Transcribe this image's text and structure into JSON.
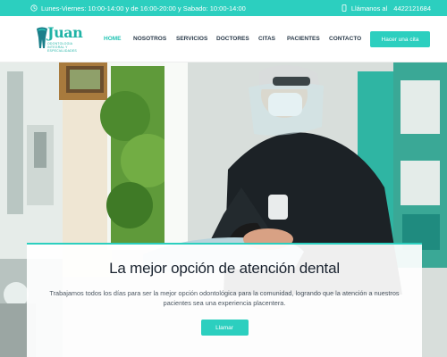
{
  "topbar": {
    "hours": "Lunes-Viernes: 10:00-14:00 y de 16:00-20:00 y Sabado: 10:00-14:00",
    "call_label": "Llámanos al",
    "phone": "4422121684",
    "clock_icon": "clock-icon",
    "phone_icon": "phone-icon"
  },
  "header": {
    "logo_word": "Juan",
    "logo_sub": "ODONTOLOGIA INTEGRAL Y ESPECIALIDADES",
    "nav": [
      {
        "label": "HOME"
      },
      {
        "label": "NOSOTROS"
      },
      {
        "label": "SERVICIOS"
      },
      {
        "label": "DOCTORES"
      },
      {
        "label": "CITAS"
      },
      {
        "label": "PACIENTES"
      },
      {
        "label": "CONTACTO"
      }
    ],
    "cta": "Hacer una cita"
  },
  "hero": {
    "title": "La mejor opción de atención dental",
    "text": "Trabajamos todos los días para ser la mejor opción odontológica para la comunidad, logrando que la atención a nuestros pacientes sea una experiencia placentera.",
    "button": "Llamar"
  },
  "colors": {
    "accent": "#2ccfbf",
    "nav_text": "#2a3a4a",
    "title_text": "#1b2430"
  }
}
